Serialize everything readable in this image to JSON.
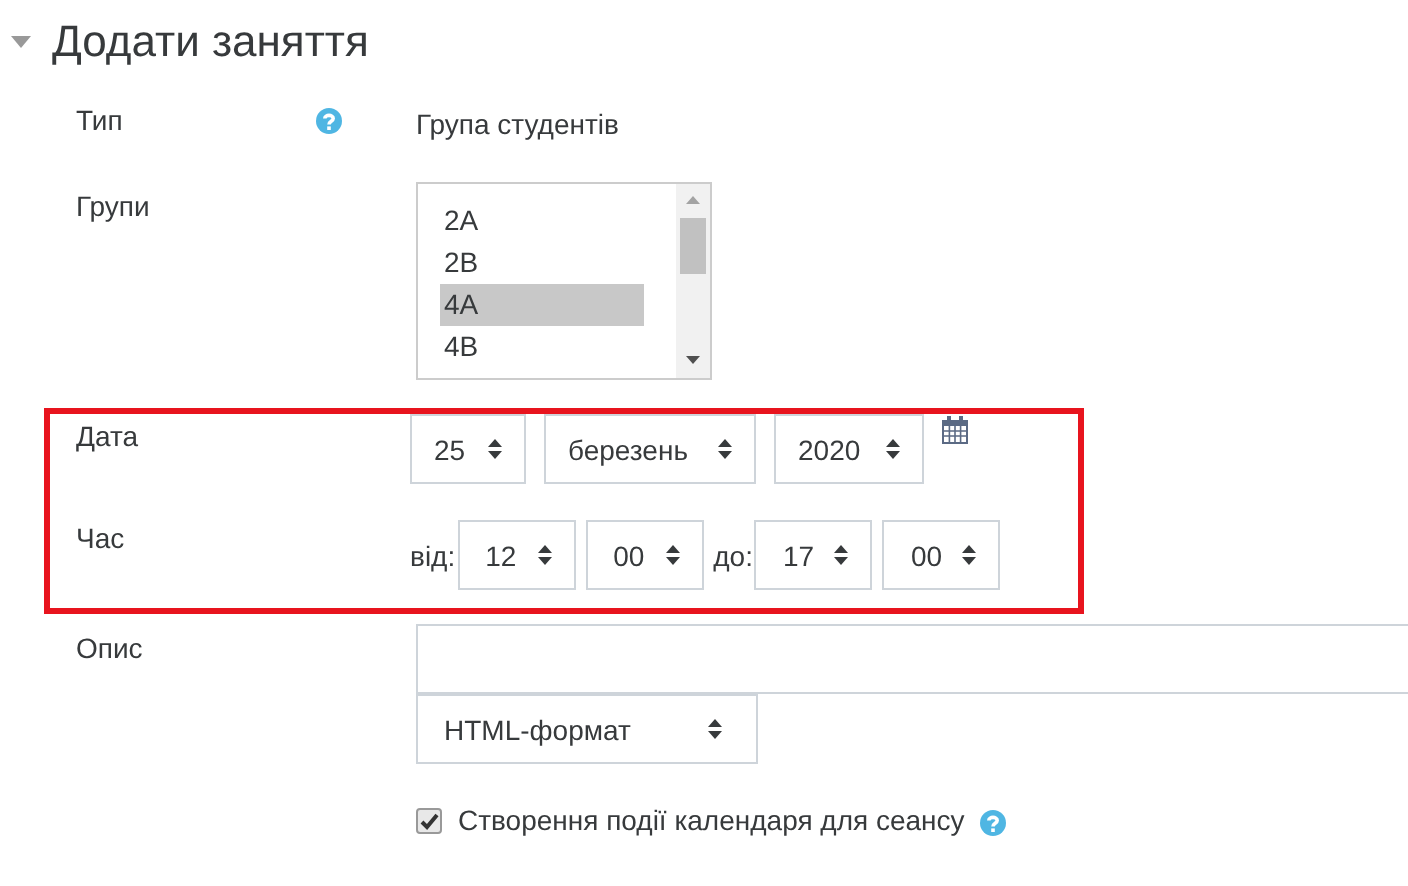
{
  "section": {
    "title": "Додати заняття",
    "expanded": true
  },
  "type_row": {
    "label": "Тип",
    "value": "Група студентів"
  },
  "groups_row": {
    "label": "Групи",
    "options": [
      {
        "label": "2A",
        "selected": false
      },
      {
        "label": "2B",
        "selected": false
      },
      {
        "label": "4A",
        "selected": true
      },
      {
        "label": "4B",
        "selected": false
      }
    ]
  },
  "highlight": {
    "color": "#e8141e"
  },
  "date_row": {
    "label": "Дата",
    "day": "25",
    "month": "березень",
    "year": "2020"
  },
  "time_row": {
    "label": "Час",
    "from_label": "від:",
    "from_hour": "12",
    "from_minute": "00",
    "to_label": "до:",
    "to_hour": "17",
    "to_minute": "00"
  },
  "description_row": {
    "label": "Опис",
    "format": "HTML-формат"
  },
  "calendar_event": {
    "label": "Створення події календаря для сеансу",
    "checked": true
  }
}
